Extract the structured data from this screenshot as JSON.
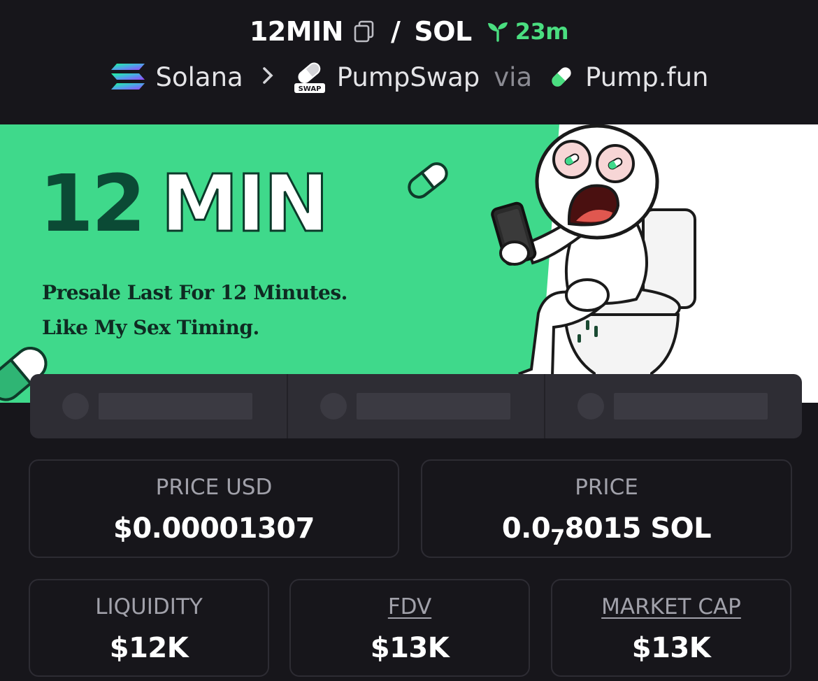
{
  "header": {
    "base_symbol": "12MIN",
    "quote_symbol": "SOL",
    "separator": "/",
    "age": "23m",
    "chain": "Solana",
    "dex": "PumpSwap",
    "via_label": "via",
    "launchpad": "Pump.fun",
    "dex_badge": "SWAP"
  },
  "banner": {
    "title_number": "12",
    "title_word": "MIN",
    "subtitle_line1": "Presale Last For 12 Minutes.",
    "subtitle_line2": "Like My Sex Timing."
  },
  "stats": {
    "price_usd": {
      "label": "PRICE USD",
      "value": "$0.00001307"
    },
    "price_native": {
      "label": "PRICE",
      "value_prefix": "0.0",
      "value_zeros": "7",
      "value_suffix": "8015 SOL"
    },
    "liquidity": {
      "label": "LIQUIDITY",
      "value": "$12K"
    },
    "fdv": {
      "label": "FDV",
      "value": "$13K"
    },
    "market_cap": {
      "label": "MARKET CAP",
      "value": "$13K"
    }
  },
  "colors": {
    "background": "#17161b",
    "banner_green": "#3fd98b",
    "age_green": "#4ade80",
    "card_border": "#2d2c33",
    "skeleton": "#2e2d34"
  },
  "icons": [
    "copy-icon",
    "seedling-icon",
    "solana-logo-icon",
    "chevron-right-icon",
    "pumpswap-logo-icon",
    "pill-icon"
  ]
}
